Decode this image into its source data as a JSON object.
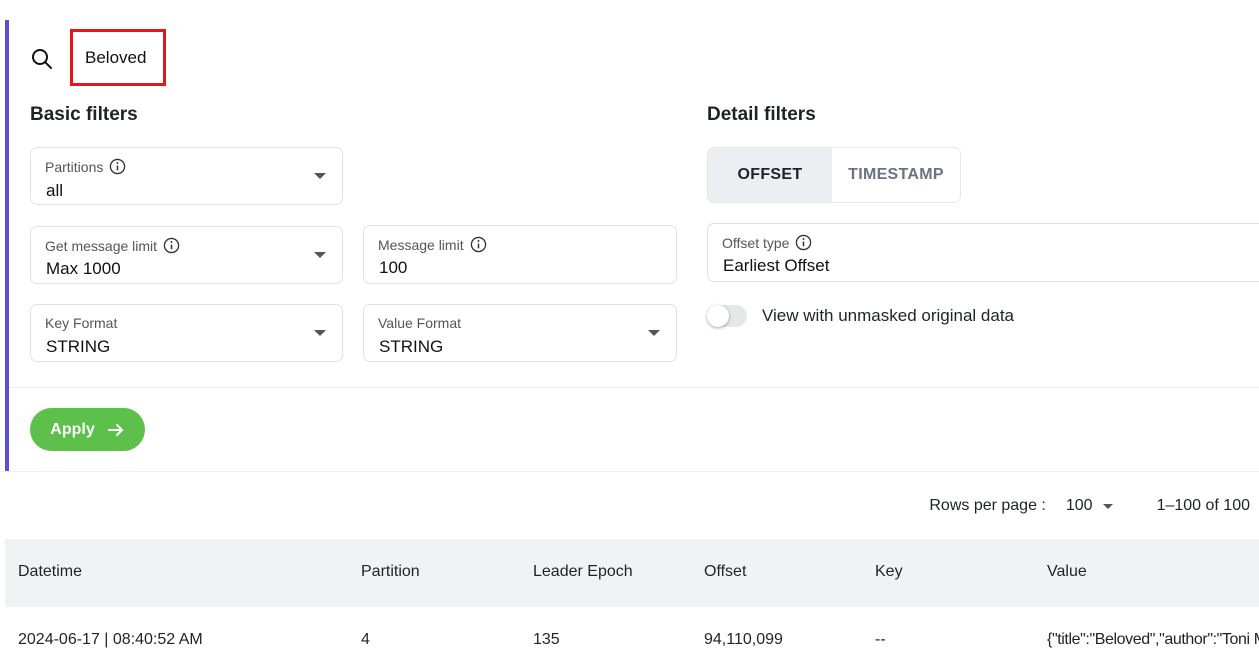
{
  "search": {
    "value": "Beloved"
  },
  "basic_filters": {
    "title": "Basic filters",
    "partitions": {
      "label": "Partitions",
      "value": "all"
    },
    "get_message_limit": {
      "label": "Get message limit",
      "value": "Max 1000"
    },
    "message_limit": {
      "label": "Message limit",
      "value": "100"
    },
    "key_format": {
      "label": "Key Format",
      "value": "STRING"
    },
    "value_format": {
      "label": "Value Format",
      "value": "STRING"
    }
  },
  "detail_filters": {
    "title": "Detail filters",
    "tabs": [
      {
        "label": "OFFSET",
        "active": true
      },
      {
        "label": "TIMESTAMP",
        "active": false
      }
    ],
    "offset_type": {
      "label": "Offset type",
      "value": "Earliest Offset"
    },
    "unmasked_toggle": {
      "label": "View with unmasked original data",
      "on": false
    }
  },
  "apply_label": "Apply",
  "pagination": {
    "rows_label": "Rows per page :",
    "rows_value": "100",
    "range": "1–100 of 100"
  },
  "table": {
    "columns": [
      "Datetime",
      "Partition",
      "Leader Epoch",
      "Offset",
      "Key",
      "Value"
    ],
    "rows": [
      {
        "datetime": "2024-06-17 | 08:40:52 AM",
        "partition": "4",
        "leader_epoch": "135",
        "offset": "94,110,099",
        "key": "--",
        "value": "{\"title\":\"Beloved\",\"author\":\"Toni Morrison\"}"
      }
    ]
  },
  "colors": {
    "accent_bar": "#5b4fd6",
    "search_highlight": "#e3161b",
    "apply_button": "#5cc04a"
  }
}
